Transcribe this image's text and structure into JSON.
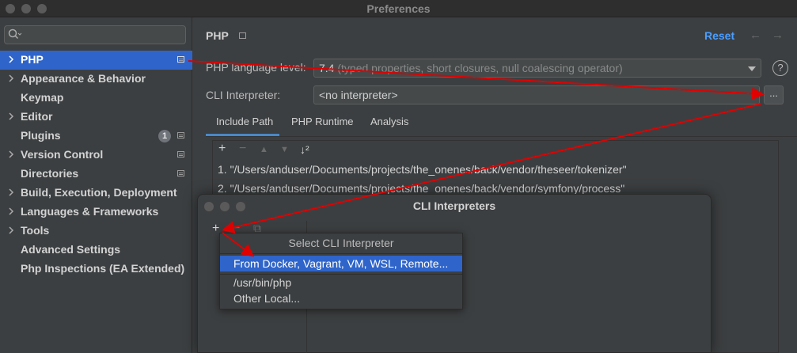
{
  "window": {
    "title": "Preferences"
  },
  "search": {
    "placeholder": "",
    "icon": "search-icon"
  },
  "sidebar": {
    "items": [
      {
        "label": "PHP",
        "expandable": true,
        "selected": true,
        "page_icon": true
      },
      {
        "label": "Appearance & Behavior",
        "expandable": true
      },
      {
        "label": "Keymap",
        "expandable": false
      },
      {
        "label": "Editor",
        "expandable": true
      },
      {
        "label": "Plugins",
        "expandable": false,
        "badge": "1",
        "page_icon": true
      },
      {
        "label": "Version Control",
        "expandable": true,
        "page_icon": true
      },
      {
        "label": "Directories",
        "expandable": false,
        "page_icon": true
      },
      {
        "label": "Build, Execution, Deployment",
        "expandable": true
      },
      {
        "label": "Languages & Frameworks",
        "expandable": true
      },
      {
        "label": "Tools",
        "expandable": true
      },
      {
        "label": "Advanced Settings",
        "expandable": false
      },
      {
        "label": "Php Inspections (EA Extended)",
        "expandable": false
      }
    ]
  },
  "main": {
    "title": "PHP",
    "reset_label": "Reset",
    "back_icon": "←",
    "forward_icon": "→",
    "language_level": {
      "label": "PHP language level:",
      "version": "7.4",
      "hint": "(typed properties, short closures, null coalescing operator)"
    },
    "help_icon": "?",
    "cli_interpreter": {
      "label": "CLI Interpreter:",
      "value": "<no interpreter>",
      "browse_label": "..."
    },
    "tabs": [
      {
        "label": "Include Path",
        "active": true
      },
      {
        "label": "PHP Runtime",
        "active": false
      },
      {
        "label": "Analysis",
        "active": false
      }
    ],
    "toolbar": {
      "add": "+",
      "remove": "−",
      "up": "▲",
      "down": "▼",
      "sort": "↓²"
    },
    "include_paths": [
      "1. \"/Users/anduser/Documents/projects/the_onenes/back/vendor/theseer/tokenizer\"",
      "2. \"/Users/anduser/Documents/projects/the_onenes/back/vendor/symfony/process\""
    ]
  },
  "dialog": {
    "title": "CLI Interpreters",
    "toolbar": {
      "add": "+",
      "remove": "−",
      "copy": "⧉"
    }
  },
  "popup": {
    "title": "Select CLI Interpreter",
    "items": [
      {
        "label": "From Docker, Vagrant, VM, WSL, Remote...",
        "selected": true
      },
      {
        "label": "/usr/bin/php",
        "selected": false
      },
      {
        "label": "Other Local...",
        "selected": false
      }
    ]
  },
  "colors": {
    "accent": "#2f65ca",
    "link": "#4a9eff",
    "annotation_arrow": "#e00000"
  }
}
